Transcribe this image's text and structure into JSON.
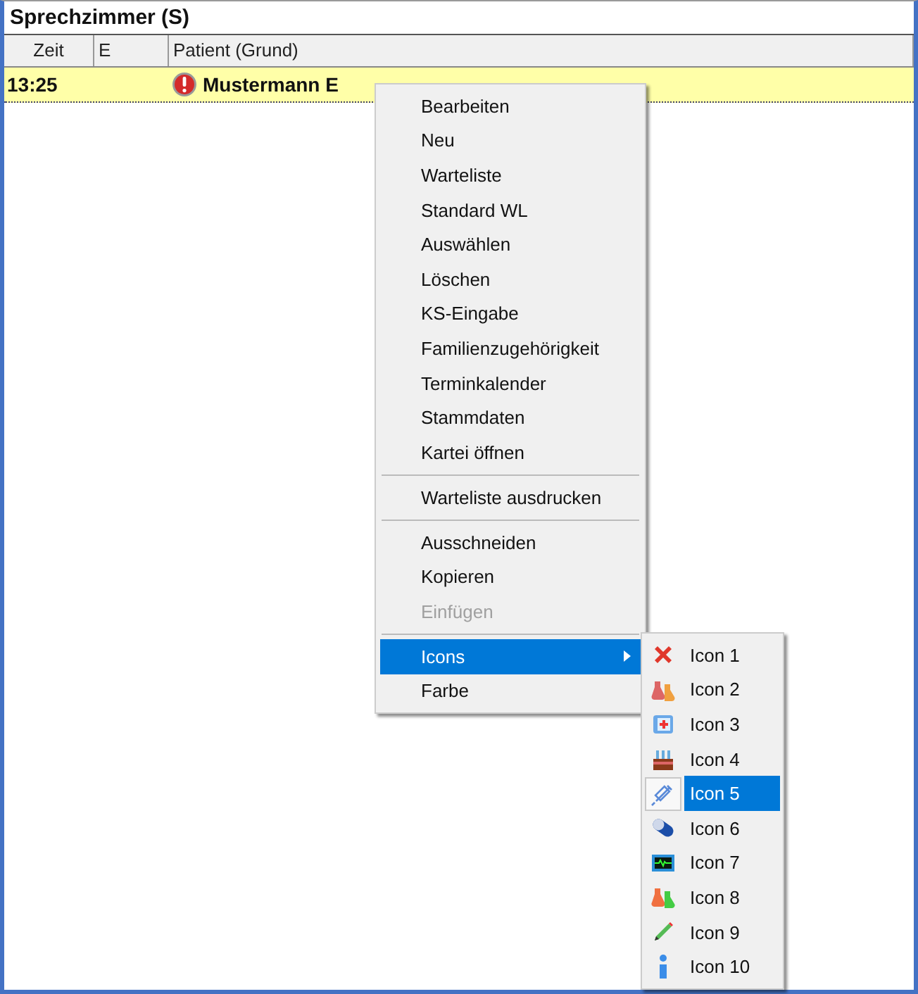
{
  "window": {
    "title": "Sprechzimmer (S)"
  },
  "table": {
    "columns": [
      "Zeit",
      "E",
      "Patient (Grund)"
    ],
    "rows": [
      {
        "time": "13:25",
        "patient": "Mustermann E",
        "alert": true,
        "selected": true
      }
    ]
  },
  "context_menu": {
    "items": [
      {
        "kind": "item",
        "label": "Bearbeiten",
        "disabled": false,
        "selected": false,
        "submenu": false
      },
      {
        "kind": "item",
        "label": "Neu",
        "disabled": false,
        "selected": false,
        "submenu": false
      },
      {
        "kind": "item",
        "label": "Warteliste",
        "disabled": false,
        "selected": false,
        "submenu": false
      },
      {
        "kind": "item",
        "label": "Standard WL",
        "disabled": false,
        "selected": false,
        "submenu": false
      },
      {
        "kind": "item",
        "label": "Auswählen",
        "disabled": false,
        "selected": false,
        "submenu": false
      },
      {
        "kind": "item",
        "label": "Löschen",
        "disabled": false,
        "selected": false,
        "submenu": false
      },
      {
        "kind": "item",
        "label": "KS-Eingabe",
        "disabled": false,
        "selected": false,
        "submenu": false
      },
      {
        "kind": "item",
        "label": "Familienzugehörigkeit",
        "disabled": false,
        "selected": false,
        "submenu": false
      },
      {
        "kind": "item",
        "label": "Terminkalender",
        "disabled": false,
        "selected": false,
        "submenu": false
      },
      {
        "kind": "item",
        "label": "Stammdaten",
        "disabled": false,
        "selected": false,
        "submenu": false
      },
      {
        "kind": "item",
        "label": "Kartei öffnen",
        "disabled": false,
        "selected": false,
        "submenu": false
      },
      {
        "kind": "separator"
      },
      {
        "kind": "item",
        "label": "Warteliste ausdrucken",
        "disabled": false,
        "selected": false,
        "submenu": false
      },
      {
        "kind": "separator"
      },
      {
        "kind": "item",
        "label": "Ausschneiden",
        "disabled": false,
        "selected": false,
        "submenu": false
      },
      {
        "kind": "item",
        "label": "Kopieren",
        "disabled": false,
        "selected": false,
        "submenu": false
      },
      {
        "kind": "item",
        "label": "Einfügen",
        "disabled": true,
        "selected": false,
        "submenu": false
      },
      {
        "kind": "separator"
      },
      {
        "kind": "item",
        "label": "Icons",
        "disabled": false,
        "selected": true,
        "submenu": true
      },
      {
        "kind": "item",
        "label": "Farbe",
        "disabled": false,
        "selected": false,
        "submenu": false
      }
    ]
  },
  "submenu": {
    "items": [
      {
        "label": "Icon 1",
        "selected": false
      },
      {
        "label": "Icon 2",
        "selected": false
      },
      {
        "label": "Icon 3",
        "selected": false
      },
      {
        "label": "Icon 4",
        "selected": false
      },
      {
        "label": "Icon 5",
        "selected": true
      },
      {
        "label": "Icon 6",
        "selected": false
      },
      {
        "label": "Icon 7",
        "selected": false
      },
      {
        "label": "Icon 8",
        "selected": false
      },
      {
        "label": "Icon 9",
        "selected": false
      },
      {
        "label": "Icon 10",
        "selected": false
      }
    ]
  }
}
